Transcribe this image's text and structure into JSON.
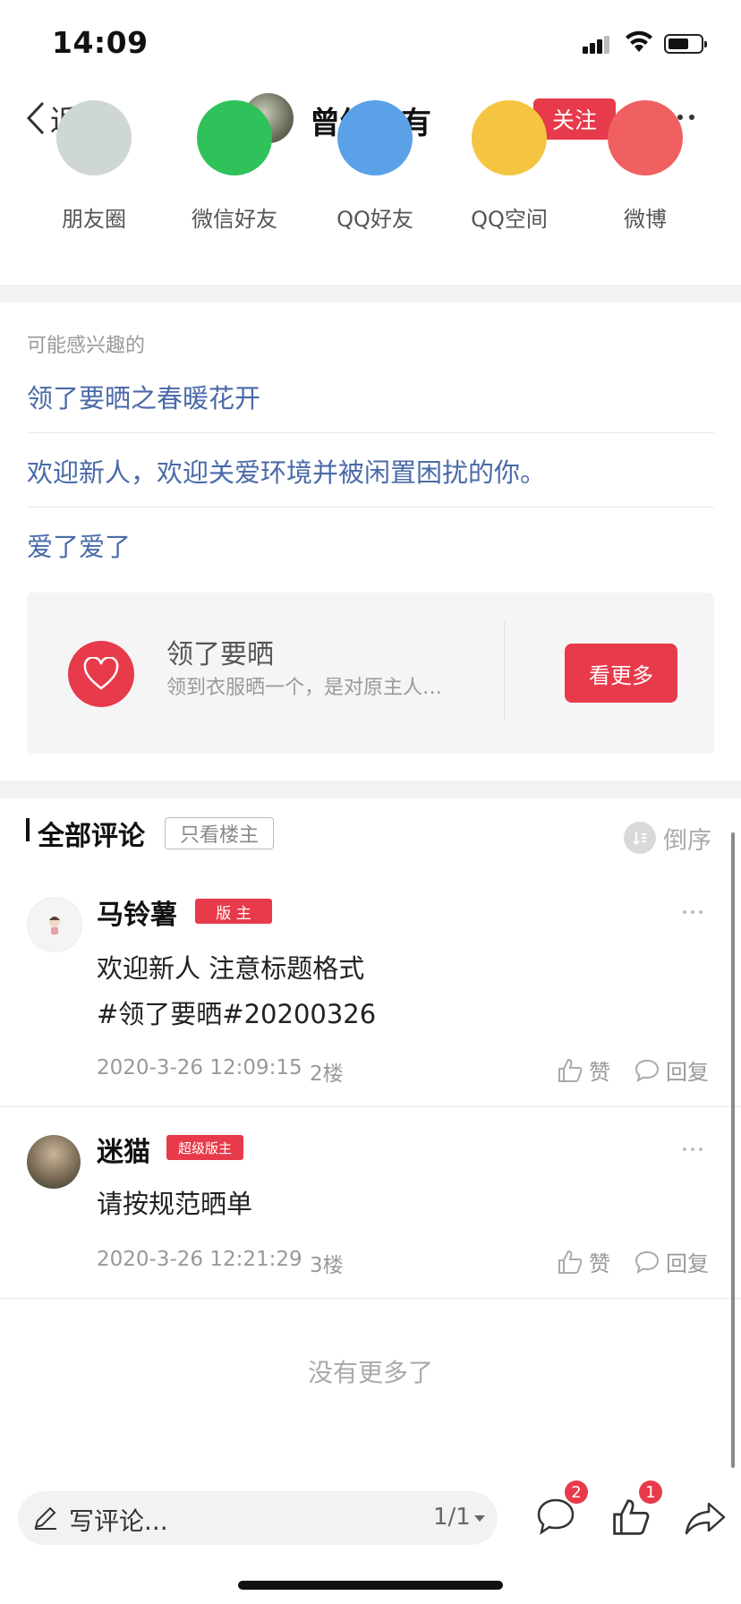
{
  "status_bar": {
    "time": "14:09"
  },
  "nav": {
    "back_label": "返回",
    "title": "曾经拥有",
    "follow_label": "关注"
  },
  "share": {
    "items": [
      {
        "label": "朋友圈",
        "color": "#cfd6d6",
        "icon": "moments-icon"
      },
      {
        "label": "微信好友",
        "color": "#2fc25b",
        "icon": "wechat-icon"
      },
      {
        "label": "QQ好友",
        "color": "#5aa1e8",
        "icon": "qq-icon"
      },
      {
        "label": "QQ空间",
        "color": "#f5c542",
        "icon": "qzone-icon"
      },
      {
        "label": "微博",
        "color": "#f06060",
        "icon": "weibo-icon"
      }
    ]
  },
  "interest": {
    "heading": "可能感兴趣的",
    "links": [
      "领了要晒之春暖花开",
      "欢迎新人，欢迎关爱环境并被闲置困扰的你。",
      "爱了爱了"
    ]
  },
  "topic_card": {
    "name": "领了要晒",
    "description": "领到衣服晒一个，是对原主人…",
    "button_label": "看更多"
  },
  "comments": {
    "title": "全部评论",
    "owner_only_label": "只看楼主",
    "reverse_label": "倒序",
    "items": [
      {
        "author": "马铃薯",
        "badge": "版 主",
        "text_lines": [
          "欢迎新人 注意标题格式",
          "#领了要晒#20200326"
        ],
        "time": "2020-3-26 12:09:15",
        "floor": "2楼",
        "like_label": "赞",
        "reply_label": "回复"
      },
      {
        "author": "迷猫",
        "badge": "超级版主",
        "text_lines": [
          "请按规范晒单"
        ],
        "time": "2020-3-26 12:21:29",
        "floor": "3楼",
        "like_label": "赞",
        "reply_label": "回复"
      }
    ],
    "no_more": "没有更多了"
  },
  "bottom_bar": {
    "placeholder": "写评论...",
    "page_indicator": "1/1",
    "comment_count": "2",
    "like_count": "1"
  },
  "colors": {
    "accent": "#e73a4a",
    "link": "#4a6aa8"
  }
}
